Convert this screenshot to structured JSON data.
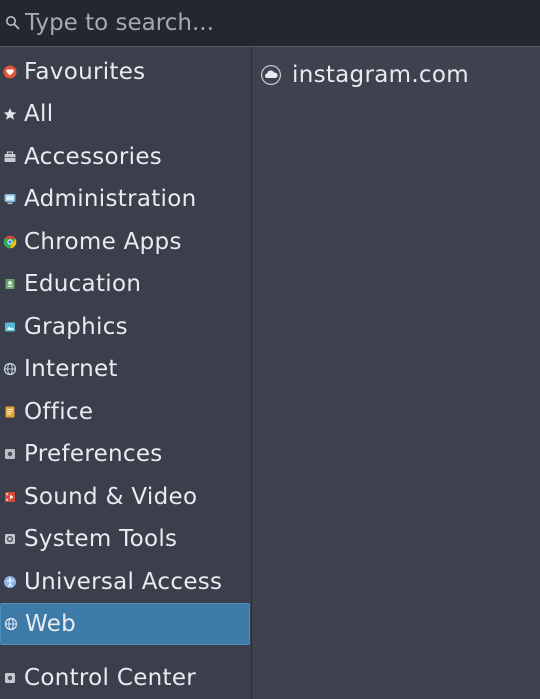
{
  "search": {
    "placeholder": "Type to search..."
  },
  "categories": [
    {
      "label": "Favourites",
      "icon": "heart-icon",
      "color": "#e2543b"
    },
    {
      "label": "All",
      "icon": "star-icon",
      "color": "#dfe3ea"
    },
    {
      "label": "Accessories",
      "icon": "toolbox-icon",
      "color": "#c9ccd2"
    },
    {
      "label": "Administration",
      "icon": "monitor-icon",
      "color": "#7fb2d8"
    },
    {
      "label": "Chrome Apps",
      "icon": "chrome-icon",
      "color": "#e6b422"
    },
    {
      "label": "Education",
      "icon": "education-icon",
      "color": "#6aa26a"
    },
    {
      "label": "Graphics",
      "icon": "graphics-icon",
      "color": "#56b8d4"
    },
    {
      "label": "Internet",
      "icon": "globe-icon",
      "color": "#c9d5e6"
    },
    {
      "label": "Office",
      "icon": "office-icon",
      "color": "#e8a33a"
    },
    {
      "label": "Preferences",
      "icon": "gear-icon",
      "color": "#b9bec6"
    },
    {
      "label": "Sound & Video",
      "icon": "multimedia-icon",
      "color": "#d64a3a"
    },
    {
      "label": "System Tools",
      "icon": "system-tools-icon",
      "color": "#c4c8cf"
    },
    {
      "label": "Universal Access",
      "icon": "accessibility-icon",
      "color": "#8eb4e8"
    },
    {
      "label": "Web",
      "icon": "web-globe-icon",
      "color": "#9fc4e4"
    },
    {
      "label": "Control Center",
      "icon": "control-center-icon",
      "color": "#c4c8cf"
    }
  ],
  "selected_category": "Web",
  "apps": [
    {
      "label": "instagram.com",
      "icon": "cloud-icon"
    }
  ],
  "colors": {
    "background": "#3a3f4b",
    "search_background": "#232830",
    "selection": "#3d7aa8"
  }
}
